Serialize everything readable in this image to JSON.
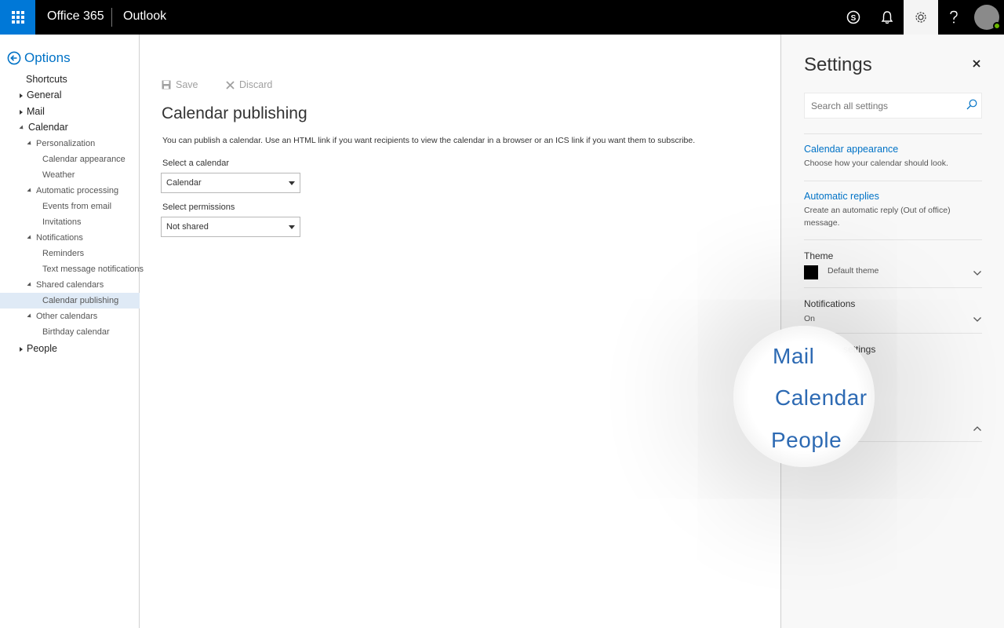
{
  "topbar": {
    "brand": "Office 365",
    "app": "Outlook"
  },
  "nav": {
    "back_label": "Options",
    "items": [
      {
        "label": "Shortcuts"
      },
      {
        "label": "General"
      },
      {
        "label": "Mail"
      },
      {
        "label": "Calendar"
      },
      {
        "label": "Personalization"
      },
      {
        "label": "Calendar appearance"
      },
      {
        "label": "Weather"
      },
      {
        "label": "Automatic processing"
      },
      {
        "label": "Events from email"
      },
      {
        "label": "Invitations"
      },
      {
        "label": "Notifications"
      },
      {
        "label": "Reminders"
      },
      {
        "label": "Text message notifications"
      },
      {
        "label": "Shared calendars"
      },
      {
        "label": "Calendar publishing"
      },
      {
        "label": "Other calendars"
      },
      {
        "label": "Birthday calendar"
      },
      {
        "label": "People"
      }
    ]
  },
  "main": {
    "save_label": "Save",
    "discard_label": "Discard",
    "title": "Calendar publishing",
    "description": "You can publish a calendar. Use an HTML link if you want recipients to view the calendar in a browser or an ICS link if you want them to subscribe.",
    "calendar_label": "Select a calendar",
    "calendar_value": "Calendar",
    "permissions_label": "Select permissions",
    "permissions_value": "Not shared"
  },
  "settings": {
    "title": "Settings",
    "search_placeholder": "Search all settings",
    "calendar_appearance": "Calendar appearance",
    "calendar_appearance_desc": "Choose how your calendar should look.",
    "automatic_replies": "Automatic replies",
    "automatic_replies_desc": "Create an automatic reply (Out of office) message.",
    "theme_label": "Theme",
    "theme_value": "Default theme",
    "notifications_label": "Notifications",
    "notifications_value": "On",
    "app_settings_partial": "settings"
  },
  "magnifier": {
    "line1": "Mail",
    "line2": "Calendar",
    "line3": "People"
  },
  "colors": {
    "accent": "#0072c6",
    "waffle": "#0078d7",
    "selected_nav": "#dfeaf6"
  }
}
